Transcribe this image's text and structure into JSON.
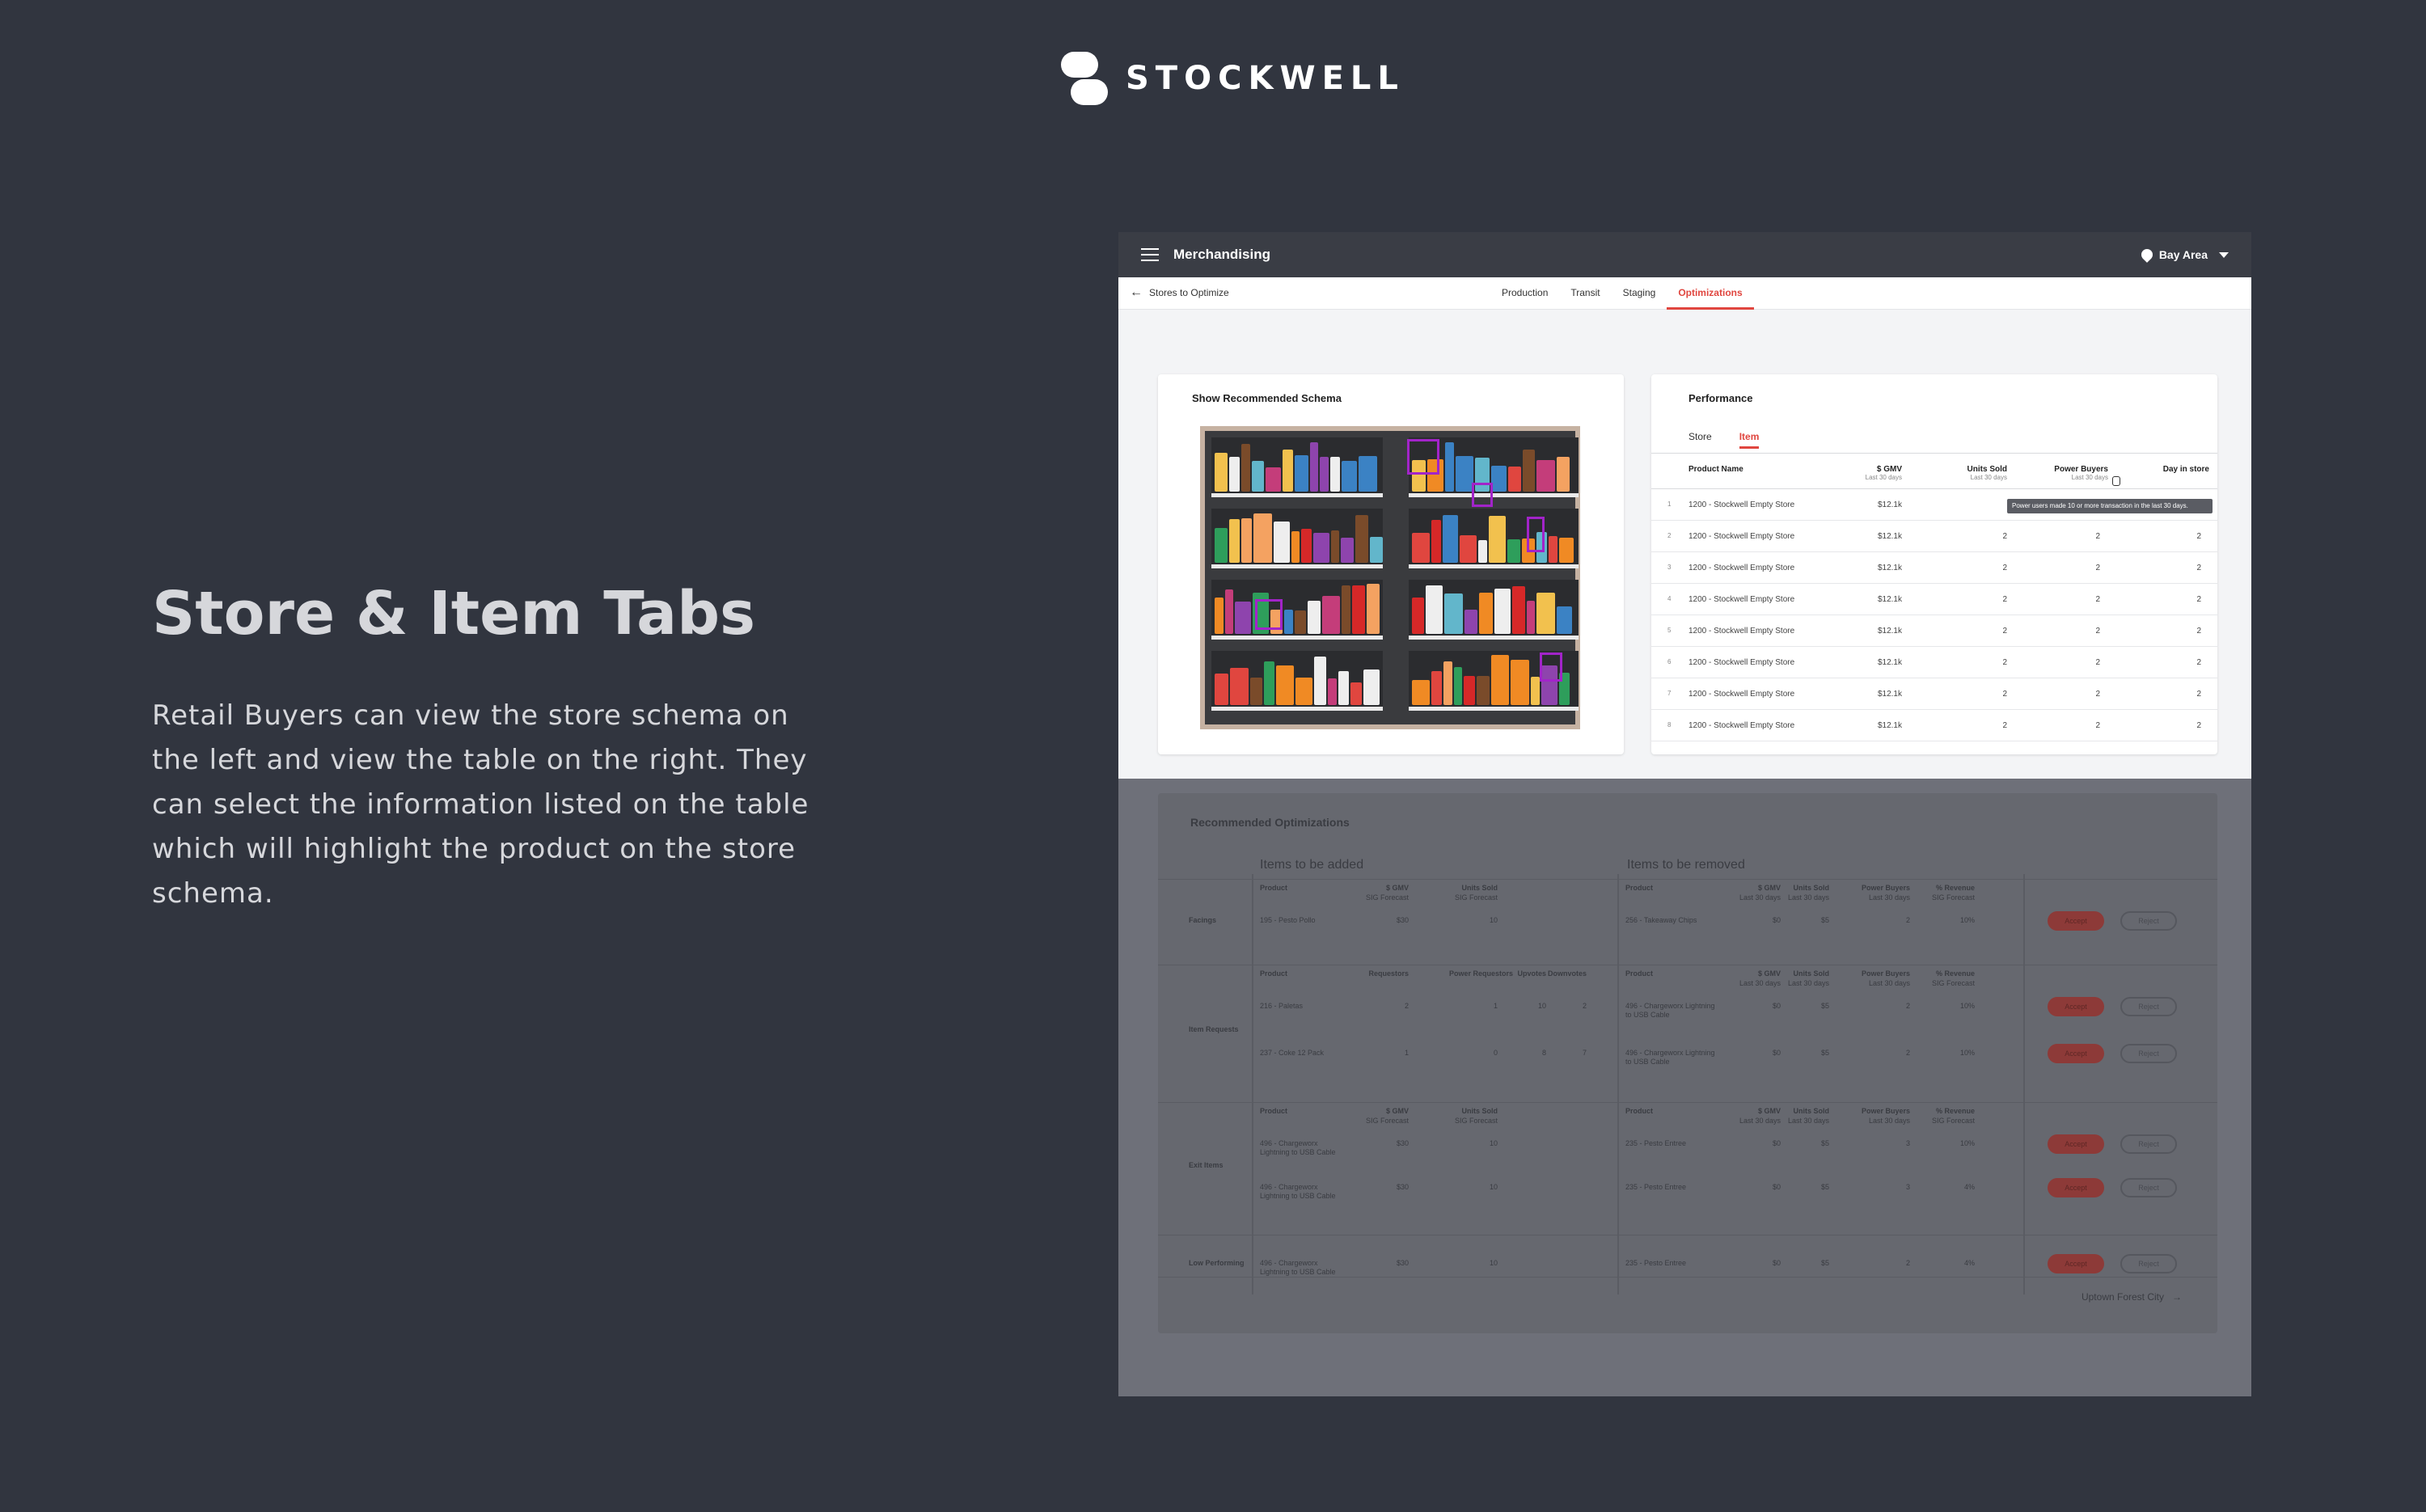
{
  "brand": {
    "name": "STOCKWELL",
    "logo": "stockwell-logo"
  },
  "slide": {
    "heading": "Store & Item Tabs",
    "body": "Retail Buyers can view the store schema on the left and view the table on the right. They can select the information listed on the table which will highlight the product on the store schema."
  },
  "app": {
    "title": "Merchandising",
    "region": "Bay Area",
    "back_label": "Stores to Optimize",
    "tabs": [
      "Production",
      "Transit",
      "Staging",
      "Optimizations"
    ],
    "active_tab": "Optimizations",
    "schema": {
      "title": "Show Recommended Schema",
      "highlight_color": "#a224c9"
    },
    "performance": {
      "title": "Performance",
      "tabs": [
        "Store",
        "Item"
      ],
      "active_tab": "Item",
      "columns": [
        {
          "label": "Product Name",
          "sub": ""
        },
        {
          "label": "$ GMV",
          "sub": "Last 30 days"
        },
        {
          "label": "Units Sold",
          "sub": "Last 30 days"
        },
        {
          "label": "Power Buyers",
          "sub": "Last 30 days"
        },
        {
          "label": "Day in store",
          "sub": ""
        }
      ],
      "tooltip": "Power users made 10 or more transaction in the last 30 days.",
      "rows": [
        {
          "n": "1",
          "name": "1200 - Stockwell Empty Store",
          "gmv": "$12.1k",
          "units": "",
          "power": "",
          "day": ""
        },
        {
          "n": "2",
          "name": "1200 - Stockwell Empty Store",
          "gmv": "$12.1k",
          "units": "2",
          "power": "2",
          "day": "2"
        },
        {
          "n": "3",
          "name": "1200 - Stockwell Empty Store",
          "gmv": "$12.1k",
          "units": "2",
          "power": "2",
          "day": "2"
        },
        {
          "n": "4",
          "name": "1200 - Stockwell Empty Store",
          "gmv": "$12.1k",
          "units": "2",
          "power": "2",
          "day": "2"
        },
        {
          "n": "5",
          "name": "1200 - Stockwell Empty Store",
          "gmv": "$12.1k",
          "units": "2",
          "power": "2",
          "day": "2"
        },
        {
          "n": "6",
          "name": "1200 - Stockwell Empty Store",
          "gmv": "$12.1k",
          "units": "2",
          "power": "2",
          "day": "2"
        },
        {
          "n": "7",
          "name": "1200 - Stockwell Empty Store",
          "gmv": "$12.1k",
          "units": "2",
          "power": "2",
          "day": "2"
        },
        {
          "n": "8",
          "name": "1200 - Stockwell Empty Store",
          "gmv": "$12.1k",
          "units": "2",
          "power": "2",
          "day": "2"
        }
      ]
    },
    "recommendations": {
      "title": "Recommended Optimizations",
      "added_title": "Items to be added",
      "removed_title": "Items to be removed",
      "groups": [
        {
          "label": "Facings",
          "add_headers": [
            "Product",
            "$ GMV",
            "Units Sold"
          ],
          "add_header_subs": [
            "",
            "SIG Forecast",
            "SIG Forecast"
          ],
          "rows": [
            {
              "add": [
                "195 - Pesto Pollo",
                "$30",
                "10"
              ],
              "remove": [
                "256 - Takeaway Chips",
                "$0",
                "$5",
                "2",
                "10%"
              ]
            }
          ]
        },
        {
          "label": "Item Requests",
          "add_headers": [
            "Product",
            "Requestors",
            "Power Requestors",
            "Upvotes",
            "Downvotes"
          ],
          "add_header_subs": [
            "",
            "",
            "",
            "",
            ""
          ],
          "rows": [
            {
              "add": [
                "216 - Paletas",
                "2",
                "1",
                "10",
                "2"
              ],
              "remove": [
                "496 - Chargeworx Lightning to USB Cable",
                "$0",
                "$5",
                "2",
                "10%"
              ]
            },
            {
              "add": [
                "237 - Coke 12 Pack",
                "1",
                "0",
                "8",
                "7"
              ],
              "remove": [
                "496 - Chargeworx Lightning to USB Cable",
                "$0",
                "$5",
                "2",
                "10%"
              ]
            }
          ]
        },
        {
          "label": "Exit Items",
          "add_headers": [
            "Product",
            "$ GMV",
            "Units Sold"
          ],
          "add_header_subs": [
            "",
            "SIG Forecast",
            "SIG Forecast"
          ],
          "rows": [
            {
              "add": [
                "496 - Chargeworx Lightning to USB Cable",
                "$30",
                "10"
              ],
              "remove": [
                "235 - Pesto Entree",
                "$0",
                "$5",
                "3",
                "10%"
              ]
            },
            {
              "add": [
                "496 - Chargeworx Lightning to USB Cable",
                "$30",
                "10"
              ],
              "remove": [
                "235 - Pesto Entree",
                "$0",
                "$5",
                "3",
                "4%"
              ]
            }
          ]
        },
        {
          "label": "Low Performing",
          "add_headers": [],
          "add_header_subs": [],
          "rows": [
            {
              "add": [
                "496 - Chargeworx Lightning to USB Cable",
                "$30",
                "10"
              ],
              "remove": [
                "235 - Pesto Entree",
                "$0",
                "$5",
                "2",
                "4%"
              ]
            }
          ]
        }
      ],
      "remove_headers": [
        "Product",
        "$ GMV",
        "Units Sold",
        "Power Buyers",
        "% Revenue"
      ],
      "remove_header_subs": [
        "",
        "Last 30 days",
        "Last 30 days",
        "Last 30 days",
        "SIG Forecast"
      ],
      "accept_label": "Accept",
      "reject_label": "Reject",
      "footer_link": "Uptown Forest City"
    }
  },
  "colors": {
    "background": "#31353f",
    "accent": "#e0463f",
    "topbar": "#3a3d45"
  }
}
